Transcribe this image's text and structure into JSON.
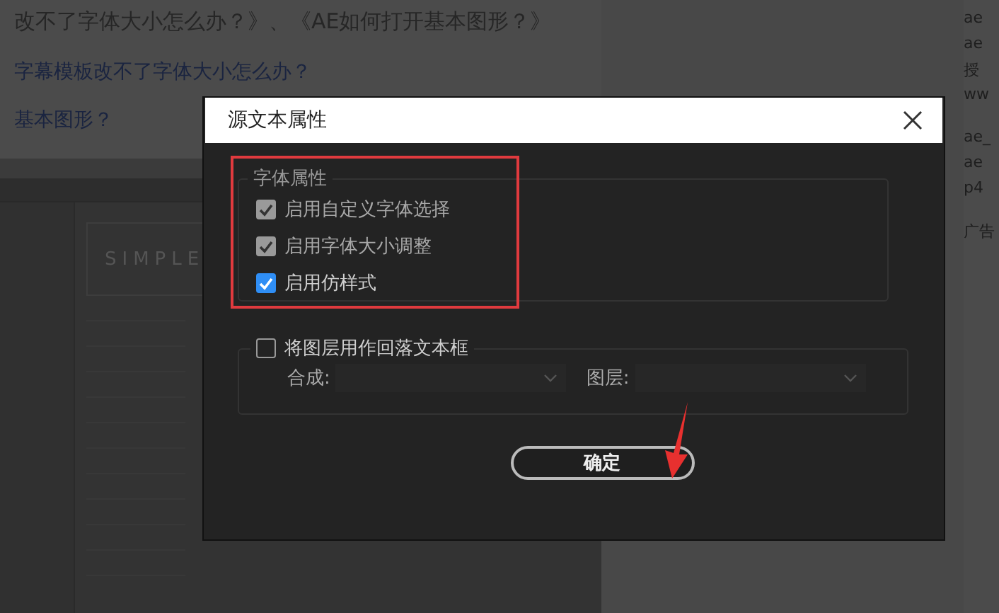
{
  "page": {
    "lines": [
      "改不了字体大小怎么办？》、《AE如何打开基本图形？》",
      "字幕模板改不了字体大小怎么办？",
      "基本图形？"
    ],
    "side": [
      "ae",
      "ae",
      "授",
      "ww",
      "ae_",
      "ae",
      "p4",
      "广告"
    ],
    "screenshot_title": "SIMPLE"
  },
  "dialog": {
    "title": "源文本属性",
    "font_group": {
      "label": "字体属性",
      "options": [
        {
          "label": "启用自定义字体选择",
          "checked": true,
          "disabled": true
        },
        {
          "label": "启用字体大小调整",
          "checked": true,
          "disabled": true
        },
        {
          "label": "启用仿样式",
          "checked": true,
          "disabled": false
        }
      ]
    },
    "fallback": {
      "label": "将图层用作回落文本框",
      "checked": false,
      "fields": [
        {
          "label": "合成:",
          "disabled": true
        },
        {
          "label": "图层:",
          "disabled": true
        }
      ]
    },
    "buttons": [
      "确定"
    ]
  }
}
